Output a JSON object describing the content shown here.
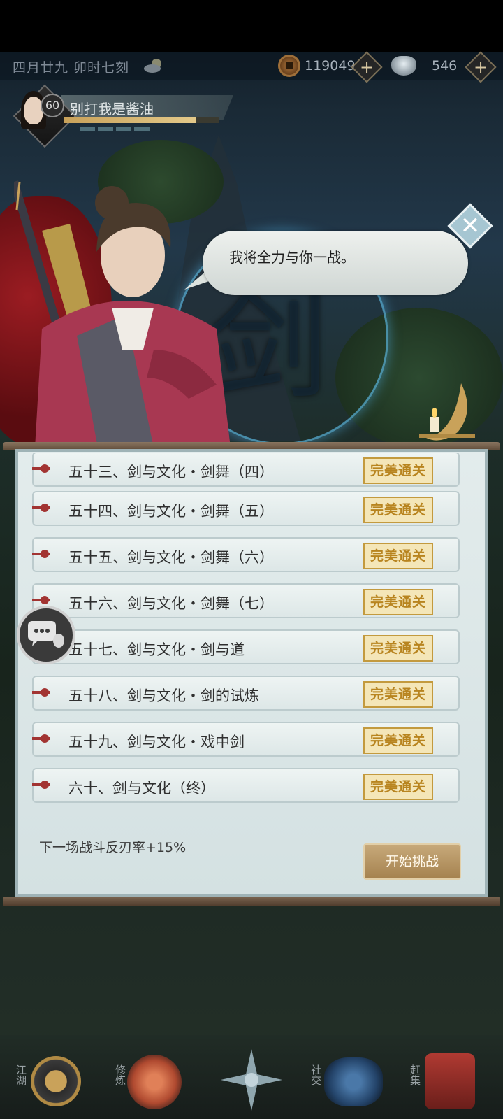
{
  "status": {
    "date": "四月廿九  卯时七刻",
    "weather_icon": "cloud-sun-icon",
    "copper": "119049",
    "silver": "546",
    "plus_label": "+"
  },
  "player": {
    "level": "60",
    "name": "别打我是酱油",
    "xp_fraction": 0.85
  },
  "dialog": {
    "text": "我将全力与你一战。",
    "close_label": "✕"
  },
  "backdrop": {
    "glyph": "剑"
  },
  "stages": [
    {
      "title": "五十三、剑与文化・剑舞（四）",
      "status": "完美通关"
    },
    {
      "title": "五十四、剑与文化・剑舞（五）",
      "status": "完美通关"
    },
    {
      "title": "五十五、剑与文化・剑舞（六）",
      "status": "完美通关"
    },
    {
      "title": "五十六、剑与文化・剑舞（七）",
      "status": "完美通关"
    },
    {
      "title": "五十七、剑与文化・剑与道",
      "status": "完美通关"
    },
    {
      "title": "五十八、剑与文化・剑的试炼",
      "status": "完美通关"
    },
    {
      "title": "五十九、剑与文化・戏中剑",
      "status": "完美通关"
    },
    {
      "title": "六十、剑与文化（终）",
      "status": "完美通关"
    }
  ],
  "bonus": "下一场战斗反刃率+15%",
  "start_button": "开始挑战",
  "nav": [
    {
      "label": "江湖",
      "icon": "jianghu-icon"
    },
    {
      "label": "修炼",
      "icon": "cultivate-icon"
    },
    {
      "label": "",
      "icon": "compass-star-icon"
    },
    {
      "label": "社交",
      "icon": "social-icon"
    },
    {
      "label": "赶集",
      "icon": "market-icon"
    }
  ],
  "colors": {
    "accent_gold": "#c39a3e",
    "marker_red": "#a23432",
    "panel_bg": "#e3ecec"
  }
}
